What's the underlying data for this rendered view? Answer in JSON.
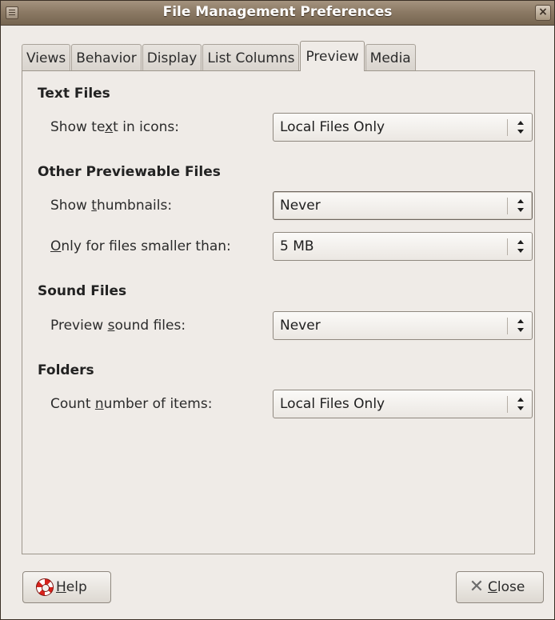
{
  "window": {
    "title": "File Management Preferences"
  },
  "tabs": [
    {
      "label": "Views"
    },
    {
      "label": "Behavior"
    },
    {
      "label": "Display"
    },
    {
      "label": "List Columns"
    },
    {
      "label": "Preview",
      "active": true
    },
    {
      "label": "Media"
    }
  ],
  "sections": {
    "text_files": {
      "title": "Text Files",
      "show_text": {
        "label_pre": "Show te",
        "label_mn": "x",
        "label_post": "t in icons:",
        "value": "Local Files Only"
      }
    },
    "other": {
      "title": "Other Previewable Files",
      "thumbnails": {
        "label_pre": "Show ",
        "label_mn": "t",
        "label_post": "humbnails:",
        "value": "Never"
      },
      "size_limit": {
        "label_pre": "",
        "label_mn": "O",
        "label_post": "nly for files smaller than:",
        "value": "5 MB"
      }
    },
    "sound": {
      "title": "Sound Files",
      "preview_sound": {
        "label_pre": "Preview ",
        "label_mn": "s",
        "label_post": "ound files:",
        "value": "Never"
      }
    },
    "folders": {
      "title": "Folders",
      "count_items": {
        "label_pre": "Count ",
        "label_mn": "n",
        "label_post": "umber of items:",
        "value": "Local Files Only"
      }
    }
  },
  "buttons": {
    "help": {
      "mn": "H",
      "rest": "elp",
      "icon": "lifebuoy-icon"
    },
    "close": {
      "mn": "C",
      "rest": "lose",
      "icon": "close-x-icon"
    }
  }
}
